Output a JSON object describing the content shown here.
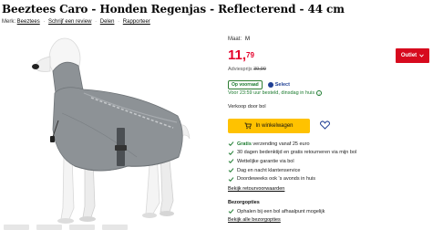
{
  "product": {
    "title": "Beeztees Caro - Honden Regenjas - Reflecterend - 44 cm",
    "brand_label": "Merk:",
    "brand": "Beeztees",
    "review_link": "Schrijf een review",
    "share_link": "Delen",
    "report_link": "Rapporteer"
  },
  "purchase": {
    "size_label": "Maat:",
    "size_value": "M",
    "price_main": "11,",
    "price_cents": "79",
    "advice_label": "Adviesprijs",
    "advice_price": "39,99",
    "stock_badge": "Op voorraad",
    "select_label": "Select",
    "delivery_text": "Voor 23:59 uur besteld, dinsdag in huis",
    "seller_text": "Verkoop door bol",
    "cart_button": "In winkelwagen",
    "outlet_button": "Outlet"
  },
  "usps": [
    {
      "bold": "Gratis",
      "text": " verzending vanaf 25 euro"
    },
    {
      "bold": "",
      "text": "30 dagen bedenktijd en gratis retourneren via mijn bol"
    },
    {
      "bold": "",
      "text": "Wettelijke garantie via bol"
    },
    {
      "bold": "",
      "text": "Dag en nacht klantenservice"
    },
    {
      "bold": "",
      "text": "Doordeweeks ook 's avonds in huis"
    }
  ],
  "links": {
    "returns": "Bekijk retourvoorwaarden",
    "pickup_title": "Bezorgopties",
    "pickup_item": "Ophalen bij een bol afhaalpunt mogelijk",
    "pickup_link": "Bekijk alle bezorgopties"
  },
  "colors": {
    "price": "#e4002b",
    "cart": "#ffc200",
    "green": "#1b7a2e",
    "outlet": "#d70a1e",
    "coat": "#8d9296"
  }
}
